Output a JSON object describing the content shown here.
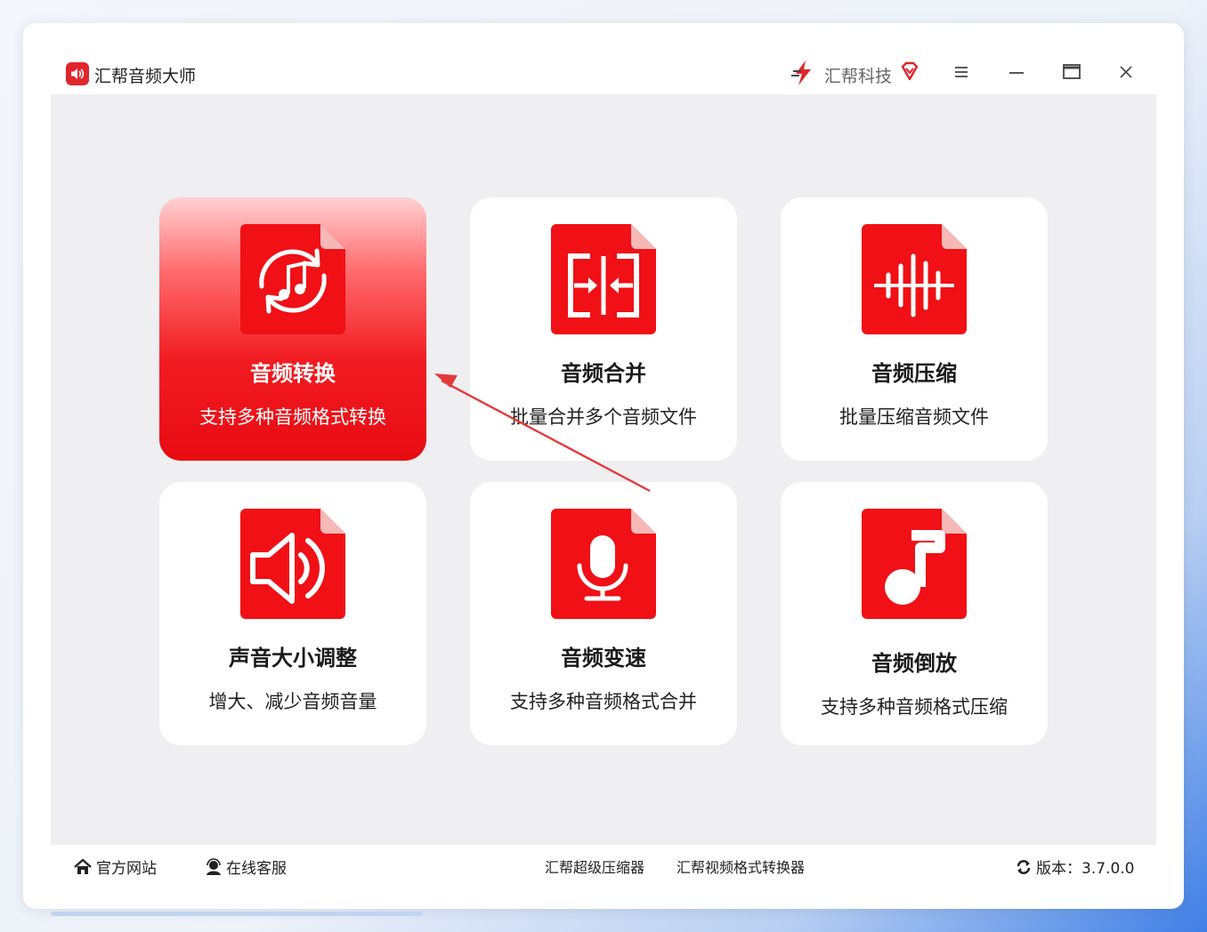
{
  "window": {
    "title": "汇帮音频大师"
  },
  "brand": {
    "name": "汇帮科技"
  },
  "colors": {
    "accent": "#e80b12",
    "accent_light": "#ffd1d1",
    "content_bg": "#efeff1"
  },
  "cards": [
    {
      "title": "音频转换",
      "desc": "支持多种音频格式转换",
      "icon": "audio-convert-icon",
      "active": true
    },
    {
      "title": "音频合并",
      "desc": "批量合并多个音频文件",
      "icon": "audio-merge-icon"
    },
    {
      "title": "音频压缩",
      "desc": "批量压缩音频文件",
      "icon": "audio-compress-icon"
    },
    {
      "title": "声音大小调整",
      "desc": "增大、减少音频音量",
      "icon": "volume-icon"
    },
    {
      "title": "音频变速",
      "desc": "支持多种音频格式合并",
      "icon": "microphone-icon"
    },
    {
      "title": "音频倒放",
      "desc": "支持多种音频格式压缩",
      "icon": "music-note-icon"
    }
  ],
  "footer": {
    "website": "官方网站",
    "service": "在线客服",
    "compressor": "汇帮超级压缩器",
    "video_converter": "汇帮视频格式转换器",
    "version": "版本：3.7.0.0"
  }
}
